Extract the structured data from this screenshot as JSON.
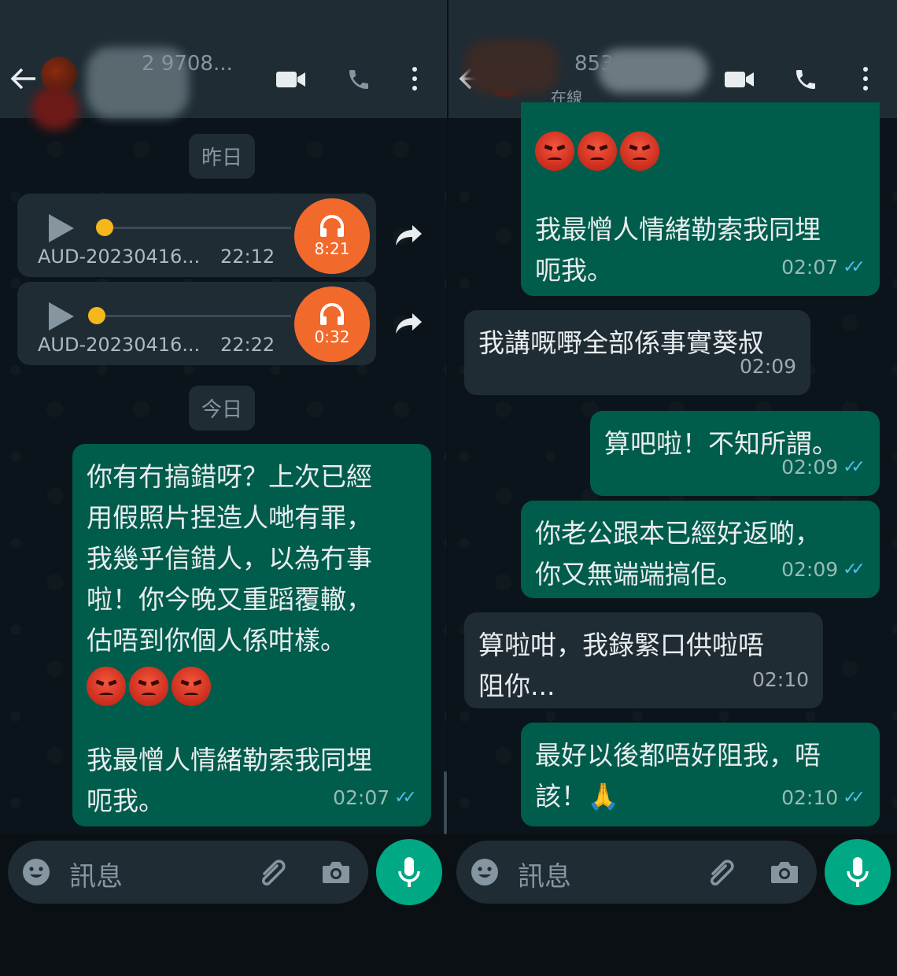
{
  "left": {
    "header": {
      "title": "2 9708..."
    },
    "date_chips": {
      "yesterday": "昨日",
      "today": "今日"
    },
    "audio_messages": [
      {
        "file": "AUD-20230416...",
        "time": "22:12",
        "duration": "8:21",
        "progress": 0.0
      },
      {
        "file": "AUD-20230416...",
        "time": "22:22",
        "duration": "0:32",
        "progress": 0.0
      }
    ],
    "message": {
      "lines": [
        "你有冇搞錯呀？上次已經",
        "用假照片捏造人哋有罪，",
        "我幾乎信錯人，以為冇事",
        "啦！你今晚又重蹈覆轍，",
        "估唔到你個人係咁樣。"
      ],
      "lines2": [
        "我最憎人情緒勒索我同埋",
        "呃我。"
      ],
      "time": "02:07"
    },
    "input": {
      "placeholder": "訊息"
    }
  },
  "right": {
    "header": {
      "title": "853",
      "status": "在線"
    },
    "messages": [
      {
        "dir": "out",
        "lines": [
          "我最憎人情緒勒索我同埋",
          "呃我。"
        ],
        "time": "02:07"
      },
      {
        "dir": "in",
        "lines": [
          "我講嘅嘢全部係事實葵叔"
        ],
        "time": "02:09"
      },
      {
        "dir": "out",
        "lines": [
          "算吧啦！不知所謂。"
        ],
        "time": "02:09"
      },
      {
        "dir": "out",
        "lines": [
          "你老公跟本已經好返啲，",
          "你又無端端搞佢。"
        ],
        "time": "02:09"
      },
      {
        "dir": "in",
        "lines": [
          "算啦咁，我錄緊口供啦唔",
          "阻你..."
        ],
        "time": "02:10"
      },
      {
        "dir": "out",
        "lines": [
          "最好以後都唔好阻我，唔",
          "該！🙏"
        ],
        "time": "02:10"
      }
    ],
    "input": {
      "placeholder": "訊息"
    }
  },
  "colors": {
    "incoming": "#1f2c34",
    "outgoing": "#005c4b",
    "accent": "#00a884",
    "audio_badge": "#f2692c",
    "read_ticks": "#53bdeb"
  }
}
